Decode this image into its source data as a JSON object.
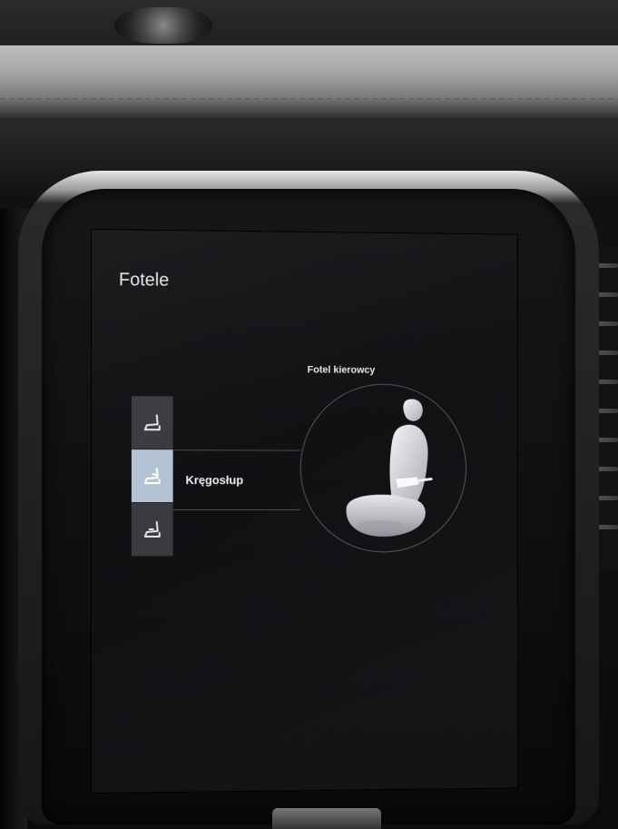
{
  "screen": {
    "title": "Fotele",
    "seat_caption": "Fotel kierowcy",
    "lumbar_label": "Kręgosłup"
  },
  "seat_buttons": [
    {
      "icon": "seat-cushion-icon",
      "active": false
    },
    {
      "icon": "seat-lumbar-icon",
      "active": true
    },
    {
      "icon": "seat-massage-icon",
      "active": false
    }
  ],
  "colors": {
    "active_button": "#b4c3d4",
    "inactive_button": "#3b3b3f",
    "screen_bg": "#121215"
  }
}
